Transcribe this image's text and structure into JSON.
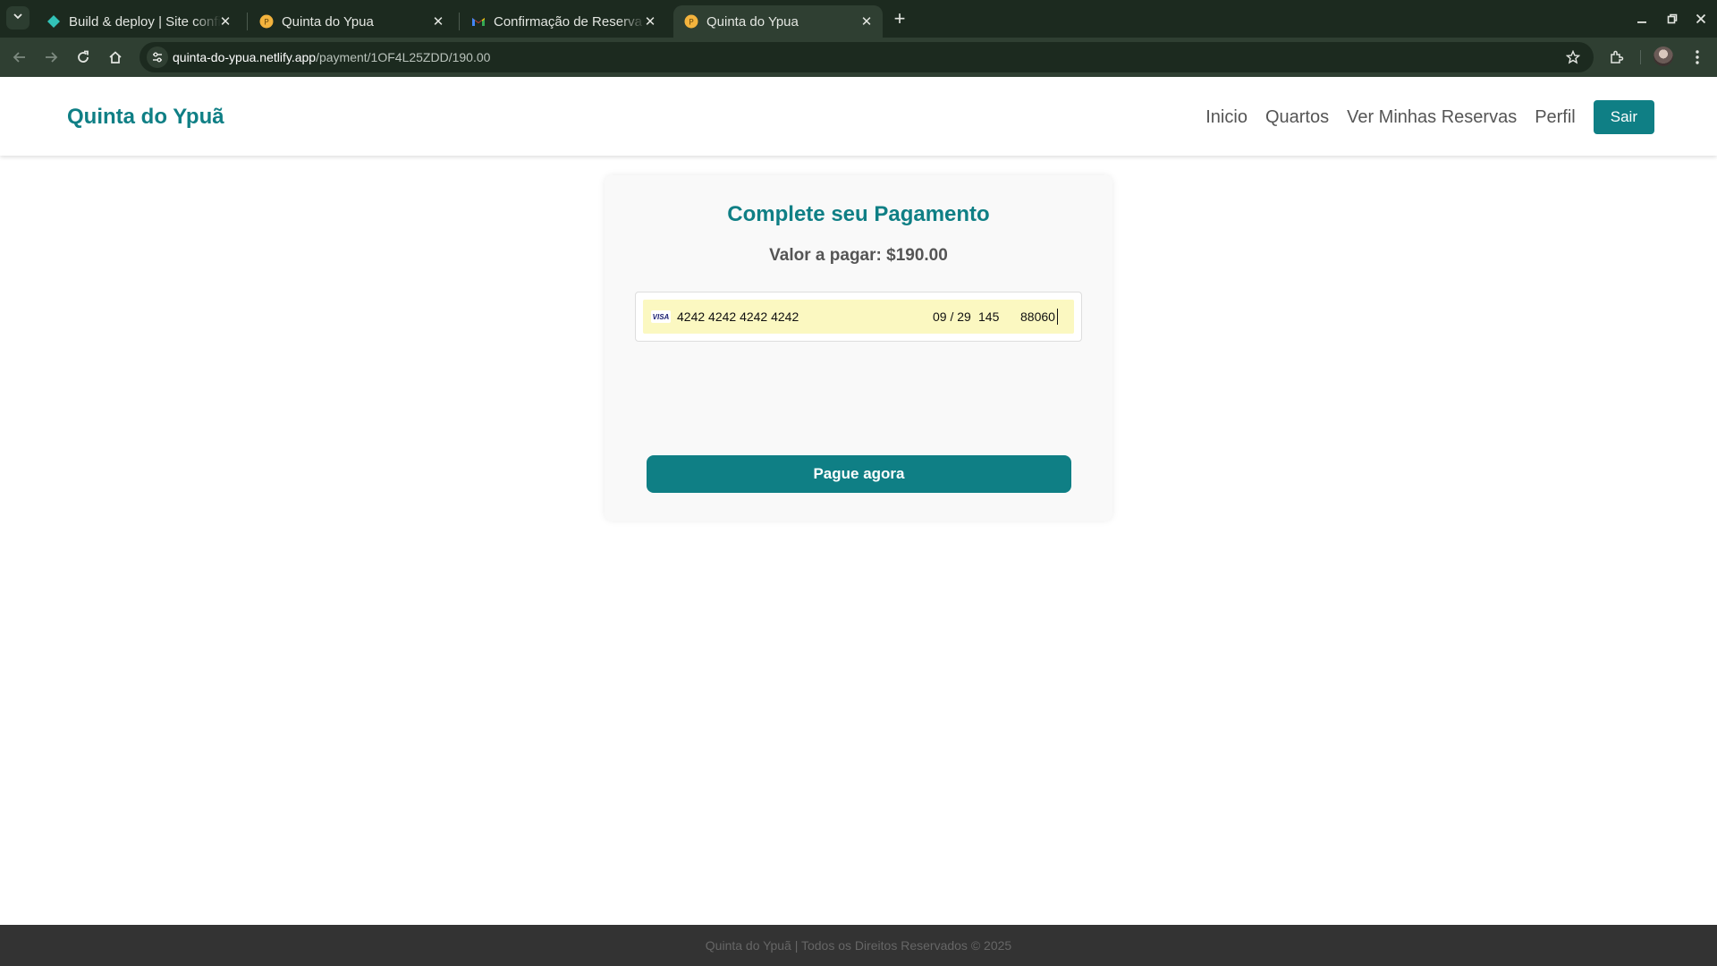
{
  "browser": {
    "tabs": [
      {
        "title": "Build & deploy | Site configuration",
        "icon": "netlify-icon",
        "active": false
      },
      {
        "title": "Quinta do Ypua",
        "icon": "site-favicon-icon",
        "active": false
      },
      {
        "title": "Confirmação de Reserva",
        "icon": "gmail-icon",
        "active": false
      },
      {
        "title": "Quinta do Ypua",
        "icon": "site-favicon-icon",
        "active": true
      }
    ],
    "url_domain": "quinta-do-ypua.netlify.app",
    "url_path": "/payment/1OF4L25ZDD/190.00",
    "colors": {
      "frame": "#1c2a1f",
      "toolbar": "#2f3f32"
    }
  },
  "header": {
    "brand": "Quinta do Ypuã",
    "nav": [
      "Inicio",
      "Quartos",
      "Ver Minhas Reservas",
      "Perfil"
    ],
    "logout_label": "Sair"
  },
  "payment": {
    "title": "Complete seu Pagamento",
    "amount_label": "Valor a pagar:",
    "amount_value": "$190.00",
    "card_brand": "VISA",
    "card_number": "4242 4242 4242 4242",
    "expiry": "09 / 29",
    "cvc": "145",
    "zip": "88060",
    "pay_button": "Pague agora"
  },
  "footer": {
    "text": "Quinta do Ypuã | Todos os Direitos Reservados © 2025"
  },
  "colors": {
    "accent": "#0f7f85",
    "autofill": "#fbf8c1",
    "footer_bg": "#333333"
  }
}
